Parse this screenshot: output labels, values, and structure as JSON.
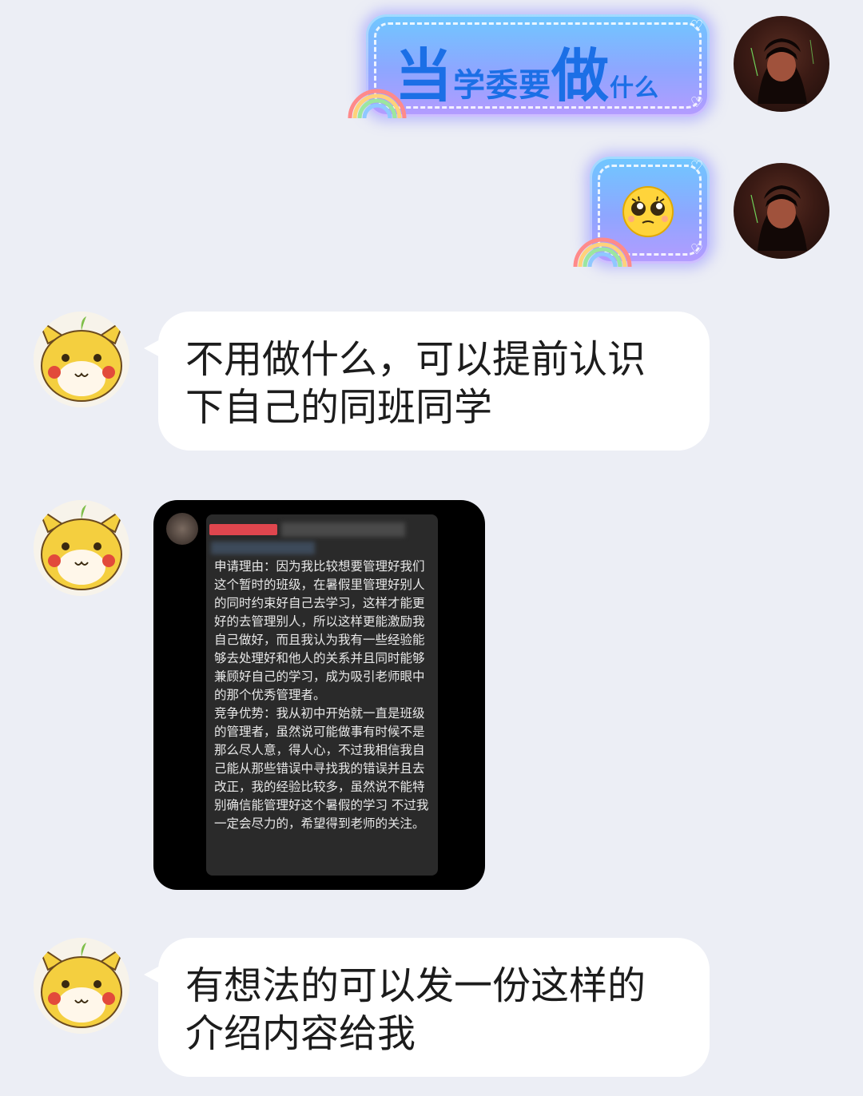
{
  "messages": {
    "outgoing_1": {
      "text_parts": [
        "当",
        "学委要",
        "做",
        "什么"
      ]
    },
    "outgoing_2": {
      "emoji": "pleading-face"
    },
    "incoming_1": {
      "text": "不用做什么，可以提前认识下自己的同班同学"
    },
    "incoming_2": {
      "image_text": "申请理由：因为我比较想要管理好我们这个暂时的班级，在暑假里管理好别人的同时约束好自己去学习，这样才能更好的去管理别人，所以这样更能激励我自己做好，而且我认为我有一些经验能够去处理好和他人的关系并且同时能够兼顾好自己的学习，成为吸引老师眼中的那个优秀管理者。\n竞争优势：我从初中开始就一直是班级的管理者，虽然说可能做事有时候不是那么尽人意，得人心，不过我相信我自己能从那些错误中寻找我的错误并且去改正，我的经验比较多，虽然说不能特别确信能管理好这个暑假的学习 不过我一定会尽力的，希望得到老师的关注。"
    },
    "incoming_3": {
      "text": "有想法的可以发一份这样的介绍内容给我"
    }
  },
  "colors": {
    "background": "#eceef5",
    "bubble_in": "#ffffff",
    "title_blue": "#1b6fe6",
    "redaction_red": "#e0464e"
  },
  "icons": [
    "user-avatar",
    "pikachu-avatar",
    "rainbow-sticker",
    "heart-icon",
    "pleading-face-emoji"
  ]
}
